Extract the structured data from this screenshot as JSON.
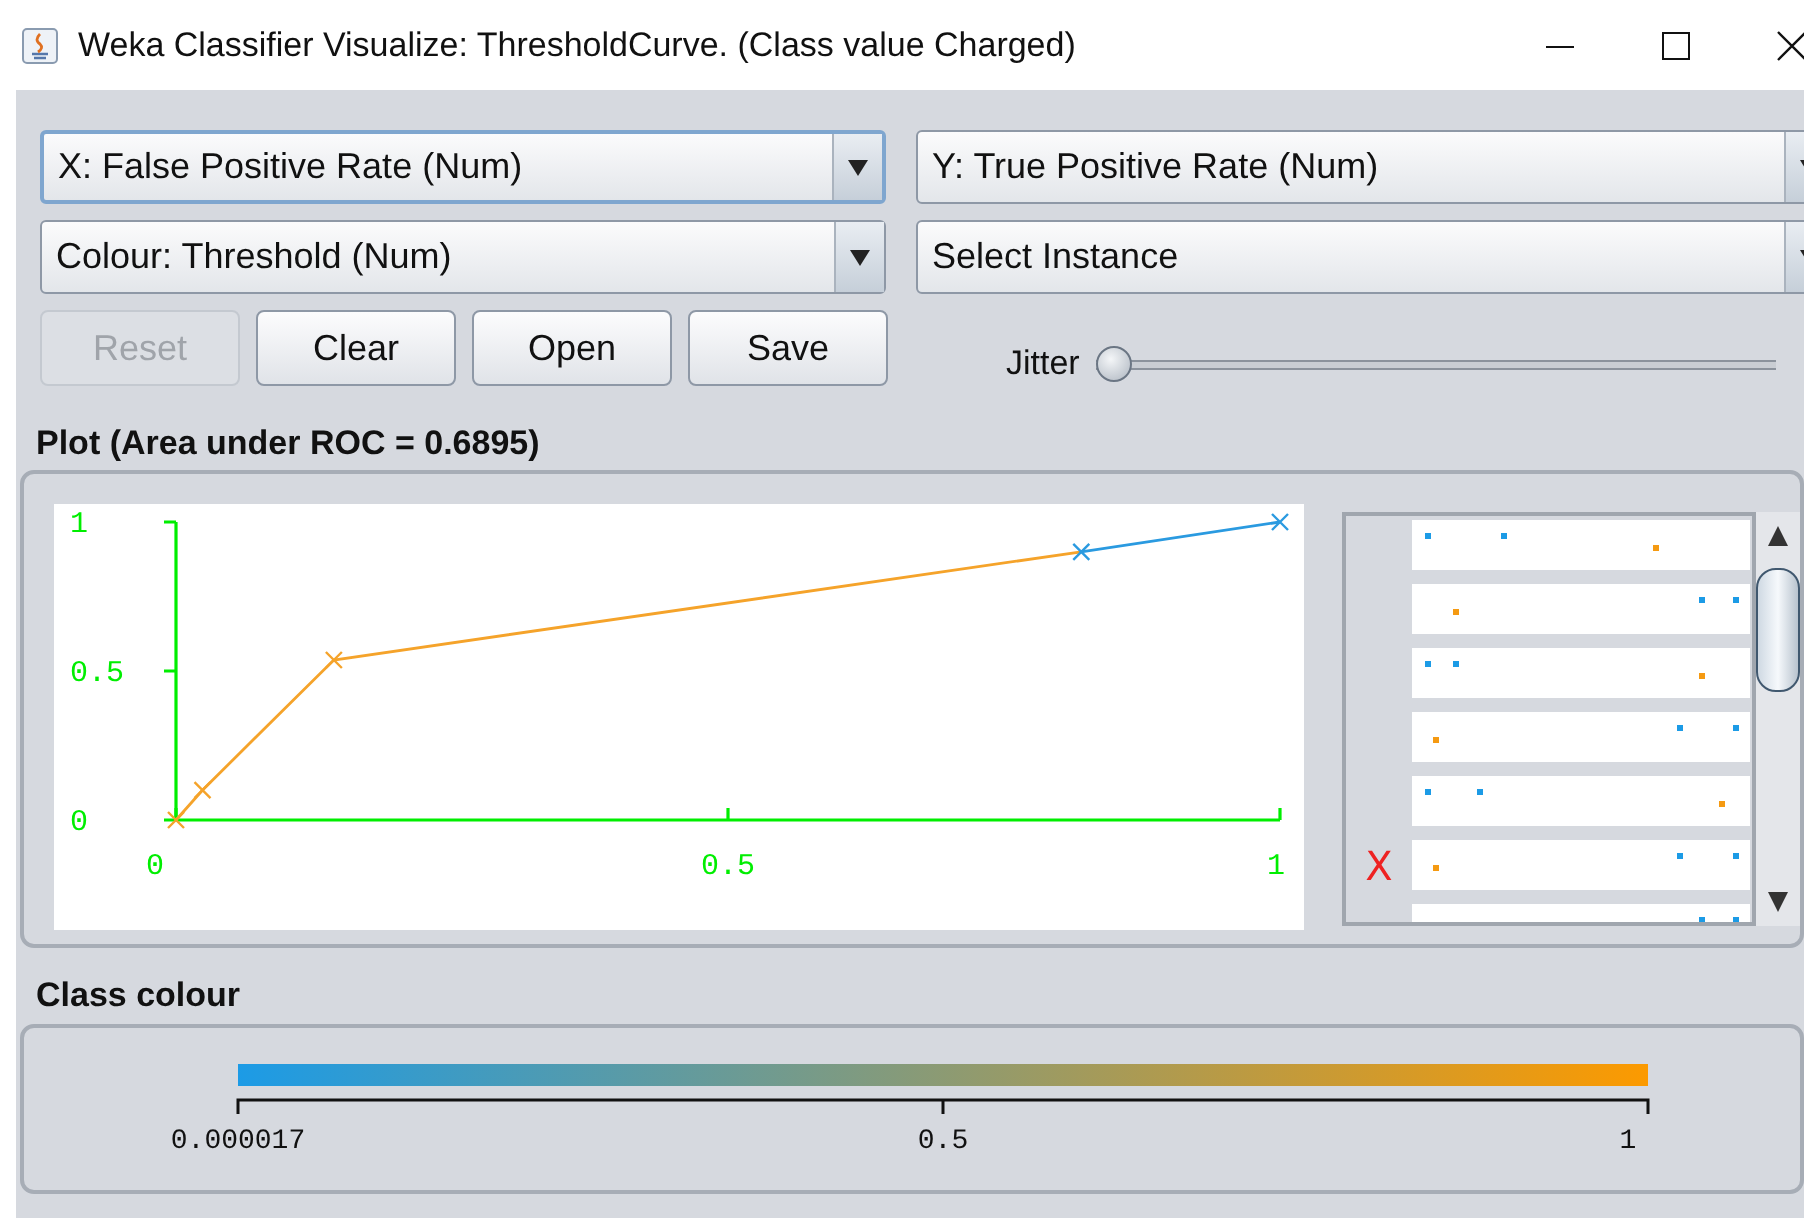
{
  "window": {
    "title": "Weka Classifier Visualize: ThresholdCurve. (Class value Charged)"
  },
  "selectors": [
    {
      "label": "X: False Positive Rate (Num)",
      "focused": true
    },
    {
      "label": "Y: True Positive Rate (Num)",
      "focused": false
    },
    {
      "label": "Colour: Threshold (Num)",
      "focused": false
    },
    {
      "label": "Select Instance",
      "focused": false
    }
  ],
  "buttons": [
    {
      "label": "Reset",
      "disabled": true
    },
    {
      "label": "Clear",
      "disabled": false
    },
    {
      "label": "Open",
      "disabled": false
    },
    {
      "label": "Save",
      "disabled": false
    }
  ],
  "jitter": {
    "label": "Jitter",
    "level": 0
  },
  "plot": {
    "title": "Plot (Area under ROC = 0.6895)",
    "chart_data": {
      "type": "line",
      "x": [
        0,
        0.024,
        0.143,
        0.82,
        1
      ],
      "xlim": [
        0,
        1
      ],
      "ylim": [
        0,
        1
      ],
      "xticks": [
        0,
        0.5,
        1
      ],
      "yticks": [
        0,
        0.5,
        1
      ],
      "series": [
        {
          "color": "#f5a32a",
          "marker": "x",
          "values": [
            0,
            0.1,
            0.537,
            0.9,
            null
          ]
        },
        {
          "color": "#2a9ae0",
          "marker": "x",
          "values": [
            null,
            null,
            null,
            0.9,
            1
          ]
        }
      ]
    }
  },
  "attribute_strips": [
    {
      "kind": "strip"
    },
    {
      "kind": "strip"
    },
    {
      "kind": "strip"
    },
    {
      "kind": "strip"
    },
    {
      "kind": "strip"
    },
    {
      "kind": "strip",
      "axis_label": "X"
    },
    {
      "kind": "strip"
    }
  ],
  "class_colour": {
    "title": "Class colour",
    "ticks": [
      "0.000017",
      "0.5",
      "1"
    ]
  }
}
